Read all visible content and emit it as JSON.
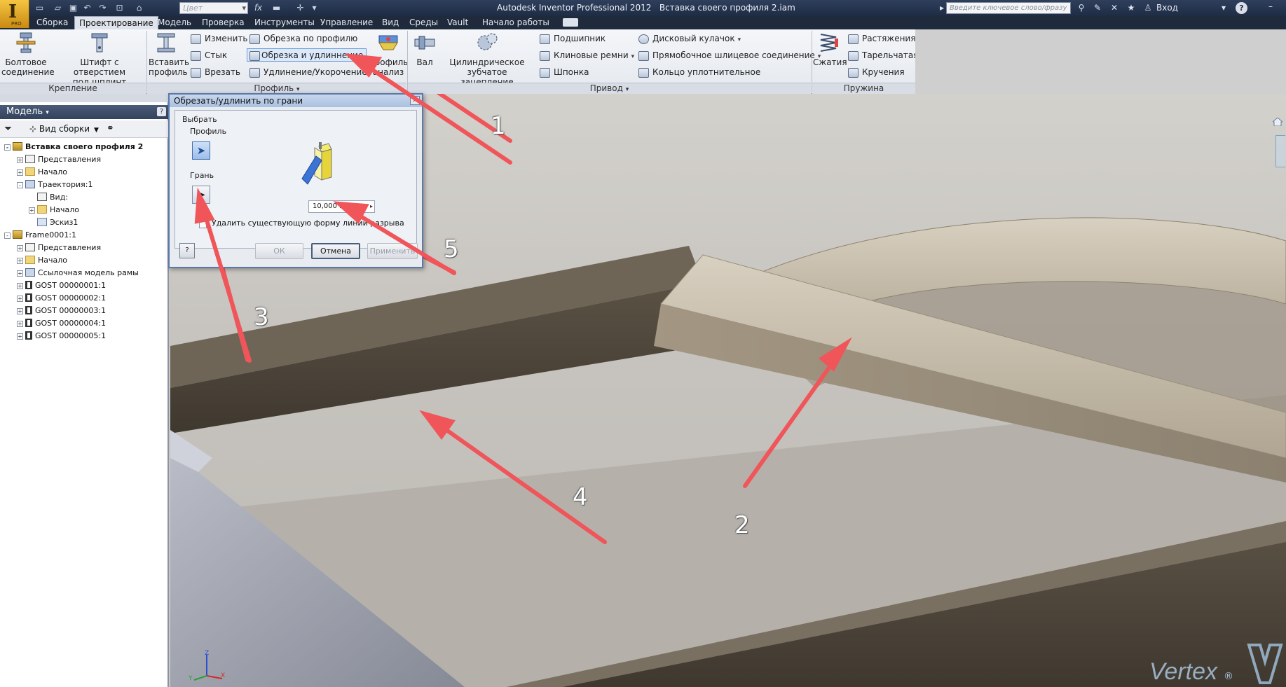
{
  "titlebar": {
    "app_title": "Autodesk Inventor Professional 2012",
    "doc_title": "Вставка своего профиля 2.iam",
    "color_combo": "Цвет",
    "fx_label": "fx",
    "search_placeholder": "Введите ключевое слово/фразу",
    "login": "Вход",
    "help": "?",
    "logo_sub": "PRO"
  },
  "tabs": [
    {
      "label": "Сборка",
      "active": false
    },
    {
      "label": "Проектирование",
      "active": true
    },
    {
      "label": "Модель",
      "active": false
    },
    {
      "label": "Проверка",
      "active": false
    },
    {
      "label": "Инструменты",
      "active": false
    },
    {
      "label": "Управление",
      "active": false
    },
    {
      "label": "Вид",
      "active": false
    },
    {
      "label": "Среды",
      "active": false
    },
    {
      "label": "Vault",
      "active": false
    },
    {
      "label": "Начало работы",
      "active": false
    }
  ],
  "ribbon": {
    "fastening": {
      "panel": "Крепление",
      "bolted": "Болтовое соединение",
      "bolted_l1": "Болтовое",
      "bolted_l2": "соединение",
      "pin_l1": "Штифт с отверстием",
      "pin_l2": "под шплинт"
    },
    "profile": {
      "panel": "Профиль",
      "insert_l1": "Вставить",
      "insert_l2": "профиль",
      "change": "Изменить",
      "miter": "Стык",
      "notch": "Врезать",
      "trim_to_frame": "Обрезка по профилю",
      "trim_extend": "Обрезка и удлиннение",
      "lengthen": "Удлинение/Укорочение",
      "analysis_l1": "Профиль",
      "analysis_l2": "анализ"
    },
    "power": {
      "panel": "Привод",
      "shaft": "Вал",
      "spur_l1": "Цилиндрическое",
      "spur_l2": "зубчатое зацепление",
      "bearing": "Подшипник",
      "vbelts": "Клиновые ремни",
      "key": "Шпонка",
      "disc_cam": "Дисковый кулачок",
      "spline": "Прямобочное шлицевое соединение",
      "oring": "Кольцо уплотнительное"
    },
    "spring": {
      "panel": "Пружина",
      "compression": "Сжатия",
      "extension": "Растяжения",
      "belleville": "Тарельчатая",
      "torsion": "Кручения"
    }
  },
  "browser": {
    "title": "Модель",
    "view_mode": "Вид сборки",
    "help": "?",
    "tree": [
      {
        "label": "Вставка своего профиля 2",
        "level": 0,
        "icon": "assy",
        "expander": "-",
        "bold": true
      },
      {
        "label": "Представления",
        "level": 1,
        "icon": "view",
        "expander": "+"
      },
      {
        "label": "Начало",
        "level": 1,
        "icon": "folder",
        "expander": "+"
      },
      {
        "label": "Траектория:1",
        "level": 1,
        "icon": "traj",
        "expander": "-"
      },
      {
        "label": "Вид:",
        "level": 2,
        "icon": "view",
        "expander": ""
      },
      {
        "label": "Начало",
        "level": 2,
        "icon": "folder",
        "expander": "+"
      },
      {
        "label": "Эскиз1",
        "level": 2,
        "icon": "sketch",
        "expander": ""
      },
      {
        "label": "Frame0001:1",
        "level": 0,
        "icon": "assy",
        "expander": "-"
      },
      {
        "label": "Представления",
        "level": 1,
        "icon": "view",
        "expander": "+"
      },
      {
        "label": "Начало",
        "level": 1,
        "icon": "folder",
        "expander": "+"
      },
      {
        "label": "Ссылочная модель рамы",
        "level": 1,
        "icon": "traj",
        "expander": "+"
      },
      {
        "label": "GOST  00000001:1",
        "level": 1,
        "icon": "beam",
        "expander": "+"
      },
      {
        "label": "GOST  00000002:1",
        "level": 1,
        "icon": "beam",
        "expander": "+"
      },
      {
        "label": "GOST  00000003:1",
        "level": 1,
        "icon": "beam",
        "expander": "+"
      },
      {
        "label": "GOST  00000004:1",
        "level": 1,
        "icon": "beam",
        "expander": "+"
      },
      {
        "label": "GOST  00000005:1",
        "level": 1,
        "icon": "beam",
        "expander": "+"
      }
    ]
  },
  "dialog": {
    "title": "Обрезать/удлинить по грани",
    "close": "x",
    "select_group": "Выбрать",
    "profile_label": "Профиль",
    "face_label": "Грань",
    "offset_value": "10,000 мм",
    "checkbox_label": "Удалить существующую форму линий разрыва",
    "checkbox_checked": false,
    "ok": "ОК",
    "cancel": "Отмена",
    "apply": "Применить",
    "help": "?"
  },
  "annotations": {
    "color": "#f0555a",
    "callouts": [
      "1",
      "2",
      "3",
      "4",
      "5"
    ]
  },
  "triad": {
    "z": "Z",
    "x": "X",
    "y": "Y"
  },
  "watermark": {
    "text": "Vertex",
    "mark": "®"
  }
}
